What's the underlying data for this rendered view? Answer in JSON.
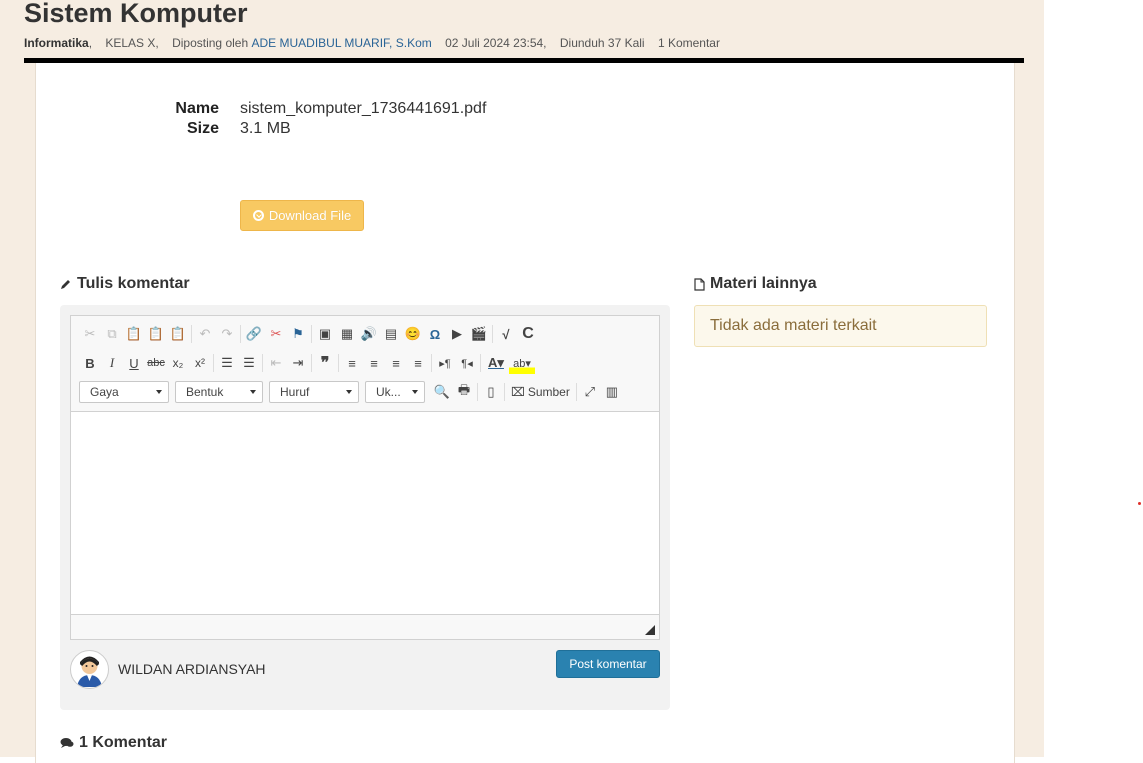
{
  "post": {
    "title": "Sistem Komputer",
    "subject": "Informatika",
    "class": "KELAS X,",
    "posted_by_prefix": "Diposting oleh",
    "author": "ADE MUADIBUL MUARIF, S.Kom",
    "date": "02 Juli 2024 23:54,",
    "downloads": "Diunduh 37 Kali",
    "comments_count": "1 Komentar"
  },
  "file": {
    "name_label": "Name",
    "name_value": "sistem_komputer_1736441691.pdf",
    "size_label": "Size",
    "size_value": "3.1 MB",
    "download_label": "Download File"
  },
  "comment_form": {
    "heading": "Tulis komentar",
    "toolbar": {
      "style_combo": "Gaya",
      "format_combo": "Bentuk",
      "font_combo": "Huruf",
      "size_combo": "Uk...",
      "source_label": "Sumber"
    },
    "user_name": "WILDAN ARDIANSYAH",
    "post_button": "Post komentar"
  },
  "sidebar": {
    "heading": "Materi lainnya",
    "empty_message": "Tidak ada materi terkait"
  },
  "comments": {
    "heading": "1 Komentar"
  },
  "colors": {
    "page_bg": "#f6ede2",
    "download_btn": "#f8c962",
    "post_btn": "#2a82b0",
    "alert_bg": "#fcf8ec"
  }
}
